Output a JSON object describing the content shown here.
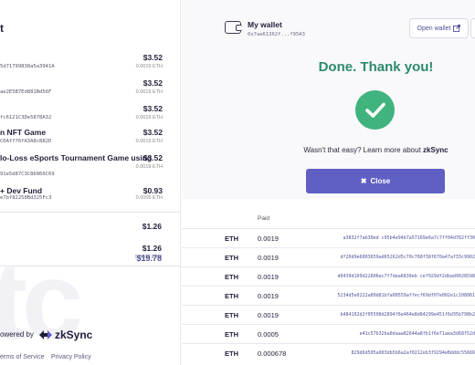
{
  "cart": {
    "title": "t",
    "items": [
      {
        "addr": "5d71799838a5a3941A",
        "price": "$3.52",
        "eth": "0.0019 ETH"
      },
      {
        "addr": "ae2E5B7Ed881Bd56F",
        "price": "$3.52",
        "eth": "0.0019 ETH"
      },
      {
        "addr": "fc6121C3De5878A32",
        "price": "$3.52",
        "eth": "0.0019 ETH"
      },
      {
        "name": "n NFT Game",
        "addr": "C6Aff76fA3A8c882D",
        "price": "$3.52",
        "eth": "0.0019 ETH"
      },
      {
        "name": "lo-Loss eSports Tournament Game using",
        "addr": "91e5d87C3C86866C69",
        "price": "$3.52",
        "eth": "0.0019 ETH"
      },
      {
        "name": "+ Dev Fund",
        "addr": "e7bf82258Bd325Fc3",
        "price": "$0.93",
        "eth": "0.0005 ETH"
      }
    ],
    "subtotals": [
      {
        "price": "$1.26"
      },
      {
        "price": "$1.26",
        "eth": "0.0006 ETH"
      }
    ],
    "total": "$19.78"
  },
  "footer": {
    "powered_by": "owered by",
    "brand": "zkSync",
    "terms": "erms of Service",
    "privacy": "Privacy Policy"
  },
  "wallet": {
    "name": "My wallet",
    "address": "0x7ae61362f...f95A3",
    "open_label": "Open wallet"
  },
  "done": {
    "title": "Done. Thank you!",
    "easy_text": "Wasn't that easy? Learn more about ",
    "easy_brand": "zkSync",
    "close_label": "Close"
  },
  "transactions": {
    "paid_header": "Paid",
    "rows": [
      {
        "token": "ETH",
        "amount": "0.0019",
        "hash": "a3832f7ab30ed c95b4e94b7a57169e6a7c7ff04d782ff30"
      },
      {
        "token": "ETH",
        "amount": "0.0019",
        "hash": "df20d9e6803659ad65262d5c70c768f38f670a47af33c9902"
      },
      {
        "token": "ETH",
        "amount": "0.0019",
        "hash": "d0439d109d22806ec7f7dea6839eb cef929df2dbad9028598"
      },
      {
        "token": "ETH",
        "amount": "0.0019",
        "hash": "5234d5e0222a80d81bfa00559affecf69df07e002e1c108061"
      },
      {
        "token": "ETH",
        "amount": "0.0019",
        "hash": "b484102d2f05508d2894f6e464e8d84299e451f6d35b798b2"
      },
      {
        "token": "ETH",
        "amount": "0.0005",
        "hash": "e41c57b32ba0daaa82644a8fb1f6e71aea3d68f52d"
      },
      {
        "token": "ETH",
        "amount": "0.000678",
        "hash": "829d6d505a903db5b6a2af0212eb3f9294eBdddc55666"
      }
    ]
  },
  "colors": {
    "accent": "#5f5fc4",
    "success": "#40b37e",
    "success_text": "#2e8a6c"
  }
}
